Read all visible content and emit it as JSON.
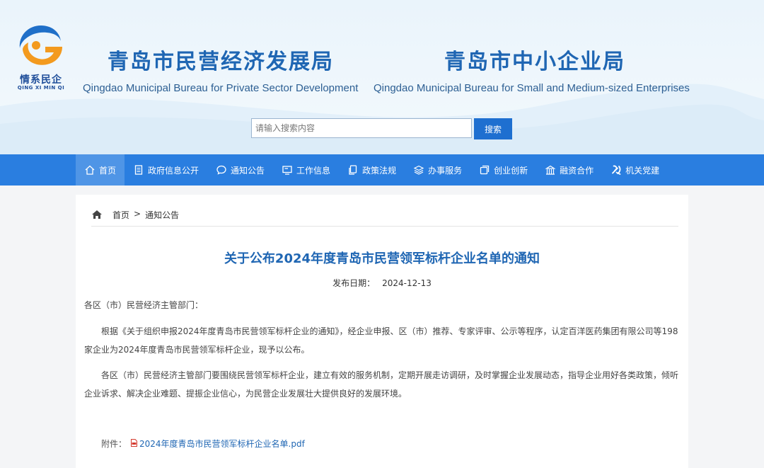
{
  "header": {
    "logo": {
      "cn": "情系民企",
      "pinyin": "QING XI MIN QI"
    },
    "left_bureau": {
      "cn": "青岛市民营经济发展局",
      "en": "Qingdao Municipal Bureau for Private Sector Development"
    },
    "right_bureau": {
      "cn": "青岛市中小企业局",
      "en": "Qingdao Municipal Bureau for Small and Medium-sized Enterprises"
    },
    "search": {
      "placeholder": "请输入搜索内容",
      "button": "搜索"
    }
  },
  "nav": {
    "items": [
      {
        "label": "首页",
        "icon": "home-icon",
        "active": true
      },
      {
        "label": "政府信息公开",
        "icon": "document-icon"
      },
      {
        "label": "通知公告",
        "icon": "chat-icon"
      },
      {
        "label": "工作信息",
        "icon": "monitor-icon"
      },
      {
        "label": "政策法规",
        "icon": "copy-icon"
      },
      {
        "label": "办事服务",
        "icon": "layers-icon"
      },
      {
        "label": "创业创新",
        "icon": "window-icon"
      },
      {
        "label": "融资合作",
        "icon": "building-icon"
      },
      {
        "label": "机关党建",
        "icon": "party-emblem-icon"
      }
    ]
  },
  "breadcrumb": {
    "home": "首页",
    "separator": ">",
    "current": "通知公告"
  },
  "article": {
    "title": "关于公布2024年度青岛市民营领军标杆企业名单的通知",
    "date_label": "发布日期：",
    "date": "2024-12-13",
    "greeting": "各区（市）民营经济主管部门：",
    "para1": "根据《关于组织申报2024年度青岛市民营领军标杆企业的通知》，经企业申报、区（市）推荐、专家评审、公示等程序，认定百洋医药集团有限公司等198家企业为2024年度青岛市民营领军标杆企业，现予以公布。",
    "para2": "各区（市）民营经济主管部门要围绕民营领军标杆企业，建立有效的服务机制，定期开展走访调研，及时掌握企业发展动态，指导企业用好各类政策，倾听企业诉求、解决企业难题、提振企业信心，为民营企业发展壮大提供良好的发展环境。",
    "attachment_label": "附件：",
    "attachment_name": "2024年度青岛市民营领军标杆企业名单.pdf"
  },
  "colors": {
    "primary": "#1f66b3",
    "nav": "#2a7ee0",
    "nav_active": "#4f95e6",
    "button": "#1e6fd0"
  }
}
